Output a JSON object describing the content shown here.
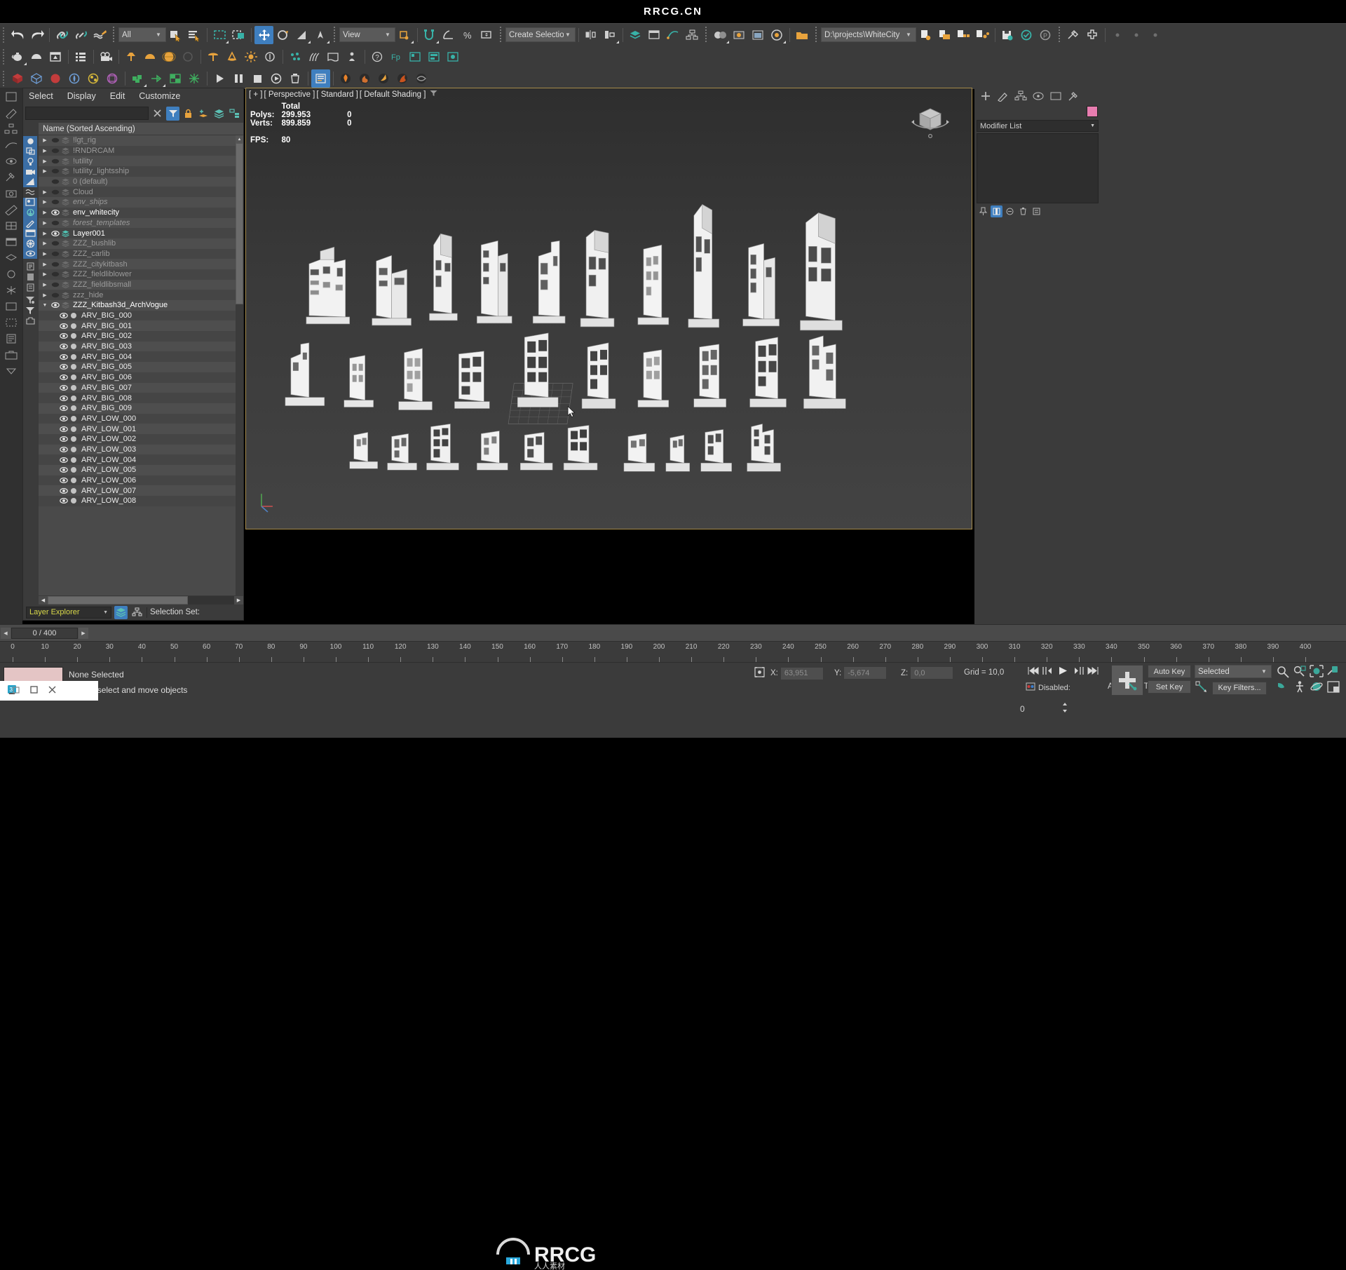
{
  "app": {
    "title": "RRCG.CN"
  },
  "toolbar": {
    "selection_filter": "All",
    "view_combo": "View",
    "named_selection": "Create Selection Se",
    "project_path": "D:\\projects\\WhiteCity"
  },
  "layer_explorer": {
    "menu": [
      "Select",
      "Display",
      "Edit",
      "Customize"
    ],
    "find_placeholder": "",
    "column_header": "Name (Sorted Ascending)",
    "footer_mode": "Layer Explorer",
    "selection_set_label": "Selection Set:",
    "layers": [
      {
        "name": "!lgt_rig",
        "style": "dim",
        "expandable": true,
        "visible": false
      },
      {
        "name": "!RNDRCAM",
        "style": "dim",
        "expandable": true,
        "visible": false
      },
      {
        "name": "!utility",
        "style": "dim",
        "expandable": true,
        "visible": false
      },
      {
        "name": "!utility_lightsship",
        "style": "dim",
        "expandable": true,
        "visible": false
      },
      {
        "name": "0 (default)",
        "style": "dim",
        "expandable": false,
        "visible": false
      },
      {
        "name": "Cloud",
        "style": "dim",
        "expandable": true,
        "visible": false
      },
      {
        "name": "env_ships",
        "style": "it",
        "expandable": true,
        "visible": false
      },
      {
        "name": "env_whitecity",
        "style": "br",
        "expandable": true,
        "visible": true
      },
      {
        "name": "forest_templates",
        "style": "it",
        "expandable": true,
        "visible": false
      },
      {
        "name": "Layer001",
        "style": "br",
        "expandable": true,
        "visible": true,
        "highlight_stack": true
      },
      {
        "name": "ZZZ_bushlib",
        "style": "dim",
        "expandable": true,
        "visible": false
      },
      {
        "name": "ZZZ_carlib",
        "style": "dim",
        "expandable": true,
        "visible": false
      },
      {
        "name": "ZZZ_citykitbash",
        "style": "dim",
        "expandable": true,
        "visible": false
      },
      {
        "name": "ZZZ_fieldliblower",
        "style": "dim",
        "expandable": true,
        "visible": false
      },
      {
        "name": "ZZZ_fieldlibsmall",
        "style": "dim",
        "expandable": true,
        "visible": false
      },
      {
        "name": "zzz_hide",
        "style": "dim",
        "expandable": true,
        "visible": false
      },
      {
        "name": "ZZZ_Kitbash3d_ArchVogue",
        "style": "br",
        "expandable": true,
        "expanded": true,
        "visible": true
      }
    ],
    "objects": [
      "ARV_BIG_000",
      "ARV_BIG_001",
      "ARV_BIG_002",
      "ARV_BIG_003",
      "ARV_BIG_004",
      "ARV_BIG_005",
      "ARV_BIG_006",
      "ARV_BIG_007",
      "ARV_BIG_008",
      "ARV_BIG_009",
      "ARV_LOW_000",
      "ARV_LOW_001",
      "ARV_LOW_002",
      "ARV_LOW_003",
      "ARV_LOW_004",
      "ARV_LOW_005",
      "ARV_LOW_006",
      "ARV_LOW_007",
      "ARV_LOW_008"
    ]
  },
  "viewport": {
    "label_parts": [
      "[ + ]",
      "[ Perspective ]",
      "[ Standard ]",
      "[ Default Shading ]"
    ],
    "stats": {
      "total_header": "Total",
      "polys_label": "Polys:",
      "polys_total": "299.953",
      "polys_sel": "0",
      "verts_label": "Verts:",
      "verts_total": "899.859",
      "verts_sel": "0",
      "fps_label": "FPS:",
      "fps_value": "80"
    }
  },
  "command_panel": {
    "modifier_list_label": "Modifier List",
    "object_color": "#e87db0"
  },
  "timeline": {
    "frame_readout": "0 / 400",
    "ruler_start": 0,
    "ruler_end": 400,
    "ruler_step": 10,
    "ruler_labels": [
      0,
      10,
      20,
      30,
      40,
      50,
      60,
      70,
      80,
      90,
      100,
      110,
      120,
      130,
      140,
      150,
      160,
      170,
      180,
      190,
      200,
      210,
      220,
      230,
      240,
      250,
      260,
      270,
      280,
      290,
      300,
      310,
      320,
      330,
      340,
      350,
      360,
      370,
      380,
      390,
      400
    ]
  },
  "status": {
    "selection": "None Selected",
    "hint": "drag to select and move objects",
    "coords": [
      {
        "label": "X:",
        "value": "63,951"
      },
      {
        "label": "Y:",
        "value": "-5,674"
      },
      {
        "label": "Z:",
        "value": "0,0"
      }
    ],
    "grid": "Grid = 10,0",
    "disabled_label": "Disabled:",
    "add_time_tag": "Add Time Tag",
    "auto_key": "Auto Key",
    "set_key": "Set Key",
    "key_mode": "Selected",
    "key_filters": "Key Filters...",
    "spinner_value": "0"
  },
  "watermark": {
    "text": "RRCG",
    "sub": "人人素材"
  },
  "colors": {
    "accent_blue": "#3f7fbf",
    "panel": "#3b3b3b",
    "viewport_bg": "#3a3a3a",
    "viewport_border": "#a58a4a",
    "teal": "#38b2a8",
    "amber": "#e8a33d"
  }
}
